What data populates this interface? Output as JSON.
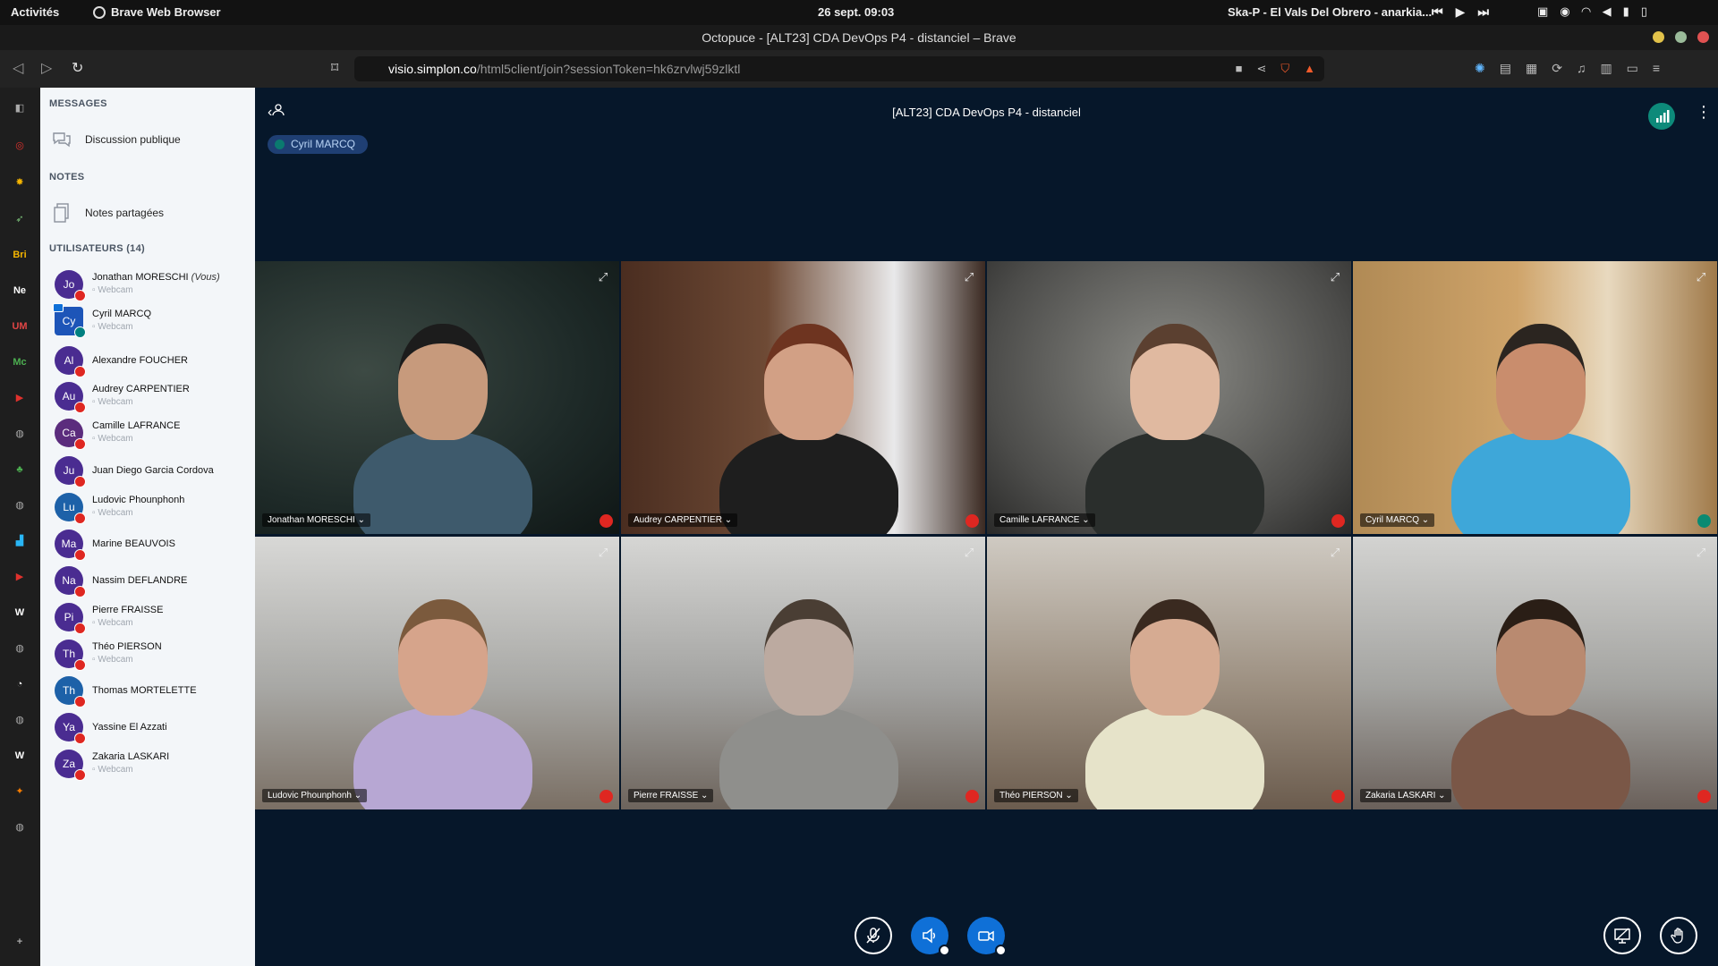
{
  "system": {
    "activities": "Activités",
    "app_name": "Brave Web Browser",
    "clock": "26 sept.  09:03",
    "media_title": "Ska-P - El Vals Del Obrero - anarkia..."
  },
  "window": {
    "title": "Octopuce - [ALT23] CDA DevOps P4 - distanciel – Brave"
  },
  "address": {
    "host": "visio.simplon.co",
    "path": "/html5client/join?sessionToken=hk6zrvlwj59zlktl"
  },
  "panel": {
    "messages_title": "MESSAGES",
    "public_chat": "Discussion publique",
    "notes_title": "NOTES",
    "shared_notes": "Notes partagées",
    "users_title": "UTILISATEURS (14)",
    "users": [
      {
        "initials": "Jo",
        "name": "Jonathan MORESCHI",
        "you": "(Vous)",
        "sub": "Webcam",
        "color": "#4a2c91"
      },
      {
        "initials": "Cy",
        "name": "Cyril MARCQ",
        "sub": "Webcam",
        "color": "#1d55b8"
      },
      {
        "initials": "Al",
        "name": "Alexandre FOUCHER",
        "color": "#4a2c91"
      },
      {
        "initials": "Au",
        "name": "Audrey CARPENTIER",
        "sub": "Webcam",
        "color": "#4a2c91"
      },
      {
        "initials": "Ca",
        "name": "Camille LAFRANCE",
        "sub": "Webcam",
        "color": "#5b2c7d"
      },
      {
        "initials": "Ju",
        "name": "Juan Diego Garcia Cordova",
        "color": "#4a2c91"
      },
      {
        "initials": "Lu",
        "name": "Ludovic Phounphonh",
        "sub": "Webcam",
        "color": "#1d61a8"
      },
      {
        "initials": "Ma",
        "name": "Marine BEAUVOIS",
        "color": "#4a2c91"
      },
      {
        "initials": "Na",
        "name": "Nassim DEFLANDRE",
        "color": "#4a2c91"
      },
      {
        "initials": "Pi",
        "name": "Pierre FRAISSE",
        "sub": "Webcam",
        "color": "#4a2c91"
      },
      {
        "initials": "Th",
        "name": "Théo PIERSON",
        "sub": "Webcam",
        "color": "#4a2c91"
      },
      {
        "initials": "Th",
        "name": "Thomas MORTELETTE",
        "color": "#1d61a8"
      },
      {
        "initials": "Ya",
        "name": "Yassine El Azzati",
        "color": "#4a2c91"
      },
      {
        "initials": "Za",
        "name": "Zakaria LASKARI",
        "sub": "Webcam",
        "color": "#4a2c91"
      }
    ]
  },
  "meeting": {
    "title": "[ALT23] CDA DevOps P4 - distanciel",
    "talking": "Cyril MARCQ",
    "tiles": [
      {
        "name": "Jonathan MORESCHI"
      },
      {
        "name": "Audrey CARPENTIER"
      },
      {
        "name": "Camille LAFRANCE"
      },
      {
        "name": "Cyril MARCQ"
      },
      {
        "name": "Ludovic Phounphonh"
      },
      {
        "name": "Pierre FRAISSE"
      },
      {
        "name": "Théo PIERSON"
      },
      {
        "name": "Zakaria LASKARI"
      }
    ]
  },
  "colors": {
    "bg": "#06172a",
    "primary": "#0f70d7",
    "muted": "#df2721",
    "panel": "#f3f6f9"
  }
}
